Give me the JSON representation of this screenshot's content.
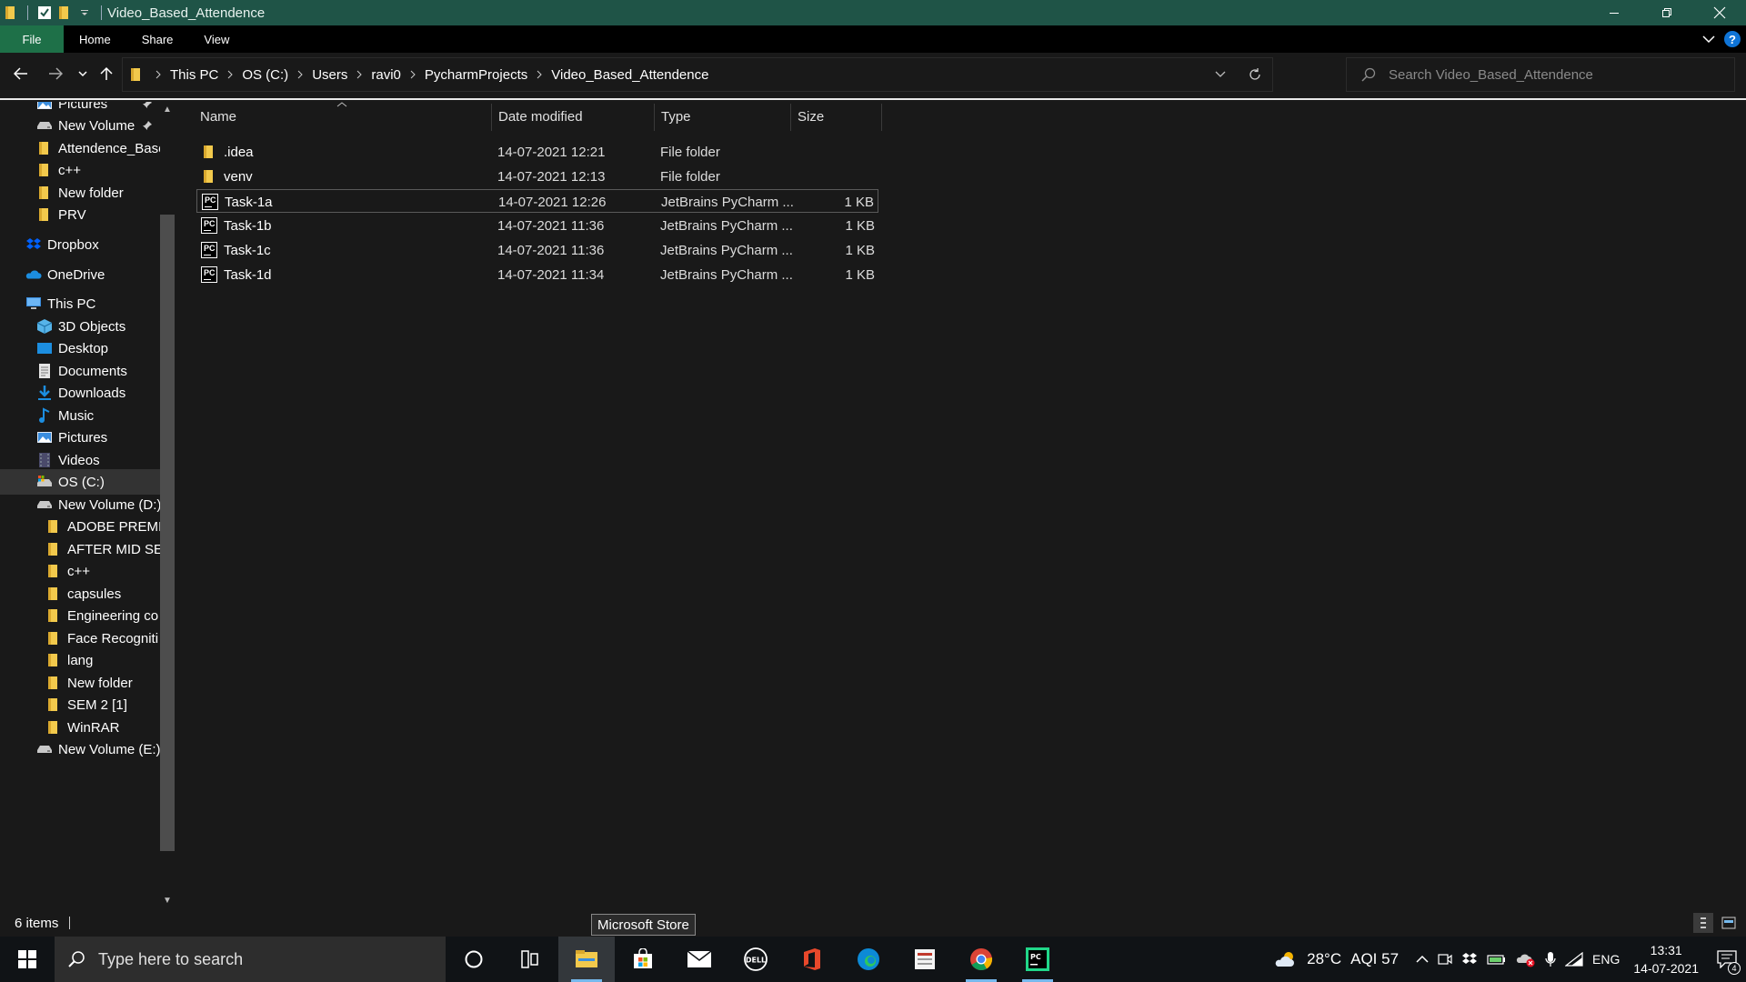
{
  "window": {
    "title": "Video_Based_Attendence",
    "controls": [
      "minimize",
      "restore",
      "close"
    ]
  },
  "ribbon": {
    "tabs": [
      "File",
      "Home",
      "Share",
      "View"
    ]
  },
  "address": {
    "crumbs": [
      "This PC",
      "OS (C:)",
      "Users",
      "ravi0",
      "PycharmProjects",
      "Video_Based_Attendence"
    ]
  },
  "search": {
    "placeholder": "Search Video_Based_Attendence"
  },
  "nav_pane": {
    "items": [
      {
        "label": "Pictures",
        "icon": "pictures-icon",
        "pinned": true
      },
      {
        "label": "New Volume",
        "icon": "drive-icon",
        "pinned": true
      },
      {
        "label": "Attendence_Base",
        "icon": "folder-icon"
      },
      {
        "label": "c++",
        "icon": "folder-icon"
      },
      {
        "label": "New folder",
        "icon": "folder-icon"
      },
      {
        "label": "PRV",
        "icon": "folder-icon"
      },
      {
        "label": "Dropbox",
        "icon": "dropbox-icon"
      },
      {
        "label": "OneDrive",
        "icon": "onedrive-icon"
      },
      {
        "label": "This PC",
        "icon": "this-pc-icon"
      },
      {
        "label": "3D Objects",
        "icon": "3d-objects-icon"
      },
      {
        "label": "Desktop",
        "icon": "desktop-icon"
      },
      {
        "label": "Documents",
        "icon": "documents-icon"
      },
      {
        "label": "Downloads",
        "icon": "downloads-icon"
      },
      {
        "label": "Music",
        "icon": "music-icon"
      },
      {
        "label": "Pictures",
        "icon": "pictures-icon"
      },
      {
        "label": "Videos",
        "icon": "videos-icon"
      },
      {
        "label": "OS (C:)",
        "icon": "os-drive-icon",
        "selected": true
      },
      {
        "label": "New Volume (D:)",
        "icon": "drive-icon"
      },
      {
        "label": "ADOBE PREMIE",
        "icon": "folder-icon"
      },
      {
        "label": "AFTER MID SEM",
        "icon": "folder-icon"
      },
      {
        "label": "c++",
        "icon": "folder-icon"
      },
      {
        "label": "capsules",
        "icon": "folder-icon"
      },
      {
        "label": "Engineering co",
        "icon": "folder-icon"
      },
      {
        "label": "Face Recogniti",
        "icon": "folder-icon"
      },
      {
        "label": "lang",
        "icon": "folder-icon"
      },
      {
        "label": "New folder",
        "icon": "folder-icon"
      },
      {
        "label": "SEM 2 [1]",
        "icon": "folder-icon"
      },
      {
        "label": "WinRAR",
        "icon": "folder-icon"
      },
      {
        "label": "New Volume (E:)",
        "icon": "drive-icon"
      }
    ]
  },
  "file_list": {
    "columns": [
      "Name",
      "Date modified",
      "Type",
      "Size"
    ],
    "rows": [
      {
        "name": ".idea",
        "date": "14-07-2021 12:21",
        "type": "File folder",
        "size": "",
        "kind": "folder"
      },
      {
        "name": "venv",
        "date": "14-07-2021 12:13",
        "type": "File folder",
        "size": "",
        "kind": "folder"
      },
      {
        "name": "Task-1a",
        "date": "14-07-2021 12:26",
        "type": "JetBrains PyCharm ...",
        "size": "1 KB",
        "kind": "pycharm",
        "selected": true
      },
      {
        "name": "Task-1b",
        "date": "14-07-2021 11:36",
        "type": "JetBrains PyCharm ...",
        "size": "1 KB",
        "kind": "pycharm"
      },
      {
        "name": "Task-1c",
        "date": "14-07-2021 11:36",
        "type": "JetBrains PyCharm ...",
        "size": "1 KB",
        "kind": "pycharm"
      },
      {
        "name": "Task-1d",
        "date": "14-07-2021 11:34",
        "type": "JetBrains PyCharm ...",
        "size": "1 KB",
        "kind": "pycharm"
      }
    ]
  },
  "status": {
    "items_count": "6 items"
  },
  "tooltip": {
    "text": "Microsoft Store"
  },
  "taskbar": {
    "search_placeholder": "Type here to search",
    "apps": [
      "cortana-icon",
      "task-view-icon",
      "file-explorer-icon",
      "microsoft-store-icon",
      "mail-icon",
      "dell-icon",
      "office-icon",
      "edge-icon",
      "tally-icon",
      "chrome-icon",
      "pycharm-icon"
    ],
    "weather": "28°C",
    "aqi": "AQI 57",
    "language": "ENG",
    "time": "13:31",
    "date": "14-07-2021",
    "notifications": "4"
  },
  "colors": {
    "titlebar": "#1f5447",
    "file_tab": "#1e7048",
    "background": "#191919",
    "folder": "#f2c94c",
    "accent": "#0f74d6"
  }
}
